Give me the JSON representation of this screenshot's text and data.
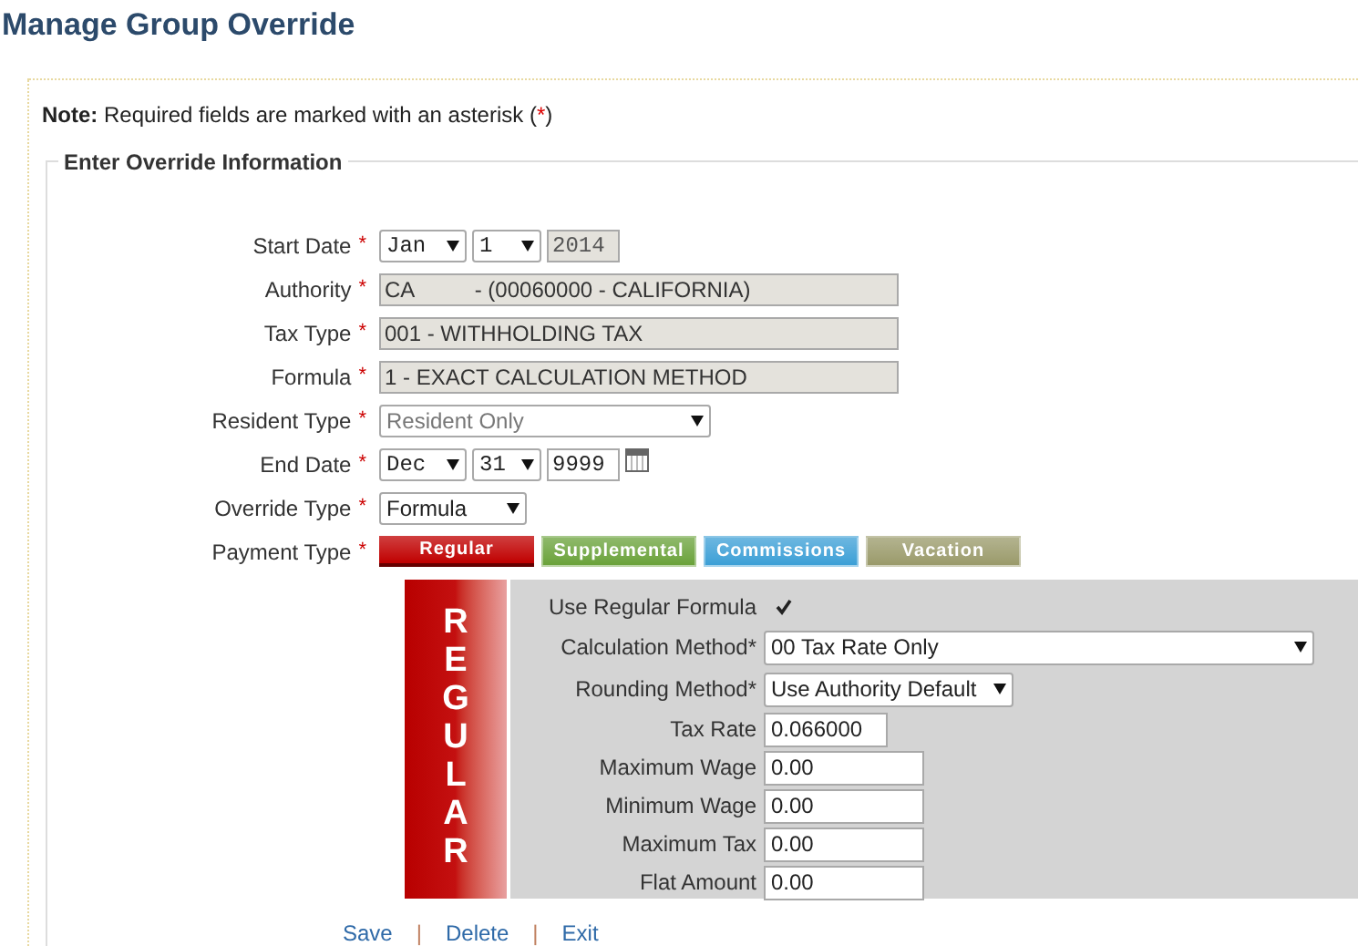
{
  "title": "Manage Group Override",
  "note": {
    "label": "Note:",
    "text": "Required fields are marked with an asterisk (",
    "mark": "*",
    "end": ")"
  },
  "legend": "Enter Override Information",
  "fields": [
    {
      "kind": "date",
      "label": "Start Date",
      "mark": "*",
      "month": "Jan",
      "day": "1",
      "year": "2014",
      "year_disabled": true,
      "calendar": false
    },
    {
      "kind": "readonly",
      "label": "Authority",
      "mark": "*",
      "value": "CA          - (00060000 - CALIFORNIA)"
    },
    {
      "kind": "readonly",
      "label": "Tax Type",
      "mark": "*",
      "value": "001 - WITHHOLDING TAX"
    },
    {
      "kind": "readonly",
      "label": "Formula",
      "mark": "*",
      "value": "1 - EXACT CALCULATION METHOD"
    },
    {
      "kind": "select",
      "label": "Resident Type",
      "mark": "*",
      "value": "Resident Only",
      "disabled": true
    },
    {
      "kind": "date",
      "label": "End Date",
      "mark": "*",
      "month": "Dec",
      "day": "31",
      "year": "9999",
      "year_disabled": false,
      "calendar": true
    },
    {
      "kind": "select",
      "label": "Override Type",
      "mark": "*",
      "value": "Formula",
      "disabled": false
    },
    {
      "kind": "tabs",
      "label": "Payment Type",
      "mark": "*",
      "tabs": [
        {
          "label": "Regular",
          "color": "#c00000",
          "selected": true
        },
        {
          "label": "Supplemental",
          "color": "#6aa23a",
          "selected": false
        },
        {
          "label": "Commissions",
          "color": "#3c9fd6",
          "selected": false
        },
        {
          "label": "Vacation",
          "color": "#9a9a6a",
          "selected": false
        }
      ]
    }
  ],
  "panel": {
    "banner": "REGULAR",
    "rows": [
      {
        "kind": "checkbox",
        "label": "Use Regular Formula",
        "checked": true
      },
      {
        "kind": "select",
        "label": "Calculation Method*",
        "value": "00 Tax Rate Only"
      },
      {
        "kind": "select",
        "label": "Rounding Method*",
        "value": "Use Authority Default"
      },
      {
        "kind": "input",
        "label": "Tax Rate",
        "value": "0.066000"
      },
      {
        "kind": "input",
        "label": "Maximum Wage",
        "value": "0.00"
      },
      {
        "kind": "input",
        "label": "Minimum Wage",
        "value": "0.00"
      },
      {
        "kind": "input",
        "label": "Maximum Tax",
        "value": "0.00"
      },
      {
        "kind": "input",
        "label": "Flat Amount",
        "value": "0.00"
      }
    ]
  },
  "actions": [
    {
      "label": "Save"
    },
    {
      "label": "Delete"
    },
    {
      "label": "Exit"
    }
  ],
  "separators": [
    "|",
    "|"
  ]
}
